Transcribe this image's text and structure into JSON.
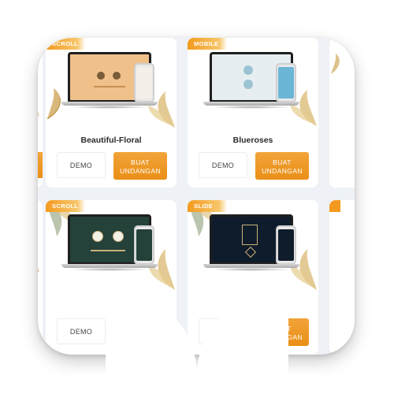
{
  "cards": [
    {
      "badge": "SCROLL",
      "title": "Beautiful-Floral",
      "demo_label": "DEMO",
      "buat_label_line1": "BUAT",
      "buat_label_line2": "UNDANGAN",
      "screen_bg": "#f0c08a",
      "phone_bg": "#f4efe8"
    },
    {
      "badge": "MOBILE",
      "title": "Blueroses",
      "demo_label": "DEMO",
      "buat_label_line1": "BUAT",
      "buat_label_line2": "UNDANGAN",
      "screen_bg": "#e7eef1",
      "phone_bg": "#6bb6d6"
    },
    {
      "badge": "SCROLL",
      "title": "",
      "demo_label": "DEMO",
      "buat_label_line1": "",
      "buat_label_line2": "",
      "screen_bg": "#24413a",
      "phone_bg": "#24413a"
    },
    {
      "badge": "SLIDE",
      "title": "",
      "demo_label": "",
      "buat_label_line1": "BUAT",
      "buat_label_line2": "UNDANGAN",
      "screen_bg": "#0f1c2b",
      "phone_bg": "#0f1c2b"
    }
  ],
  "colors": {
    "accent": "#ee9a20",
    "card_bg": "#ffffff",
    "page_bg": "#eef1f5",
    "title": "#2b2b2b"
  }
}
